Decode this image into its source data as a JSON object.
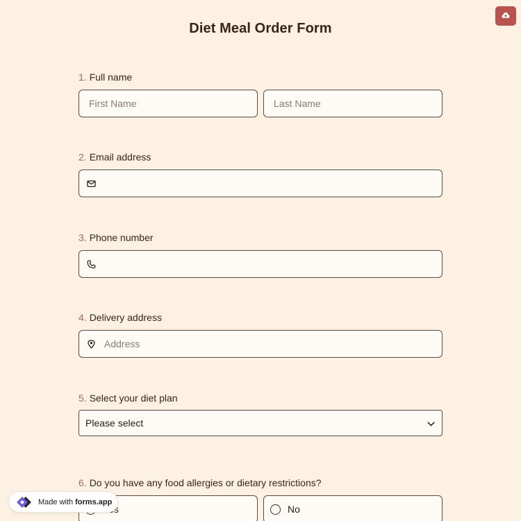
{
  "form": {
    "title": "Diet Meal Order Form"
  },
  "questions": {
    "q1": {
      "number": "1.",
      "label": "Full name",
      "first_placeholder": "First Name",
      "last_placeholder": "Last Name"
    },
    "q2": {
      "number": "2.",
      "label": "Email address",
      "icon": "envelope-icon"
    },
    "q3": {
      "number": "3.",
      "label": "Phone number",
      "icon": "phone-icon"
    },
    "q4": {
      "number": "4.",
      "label": "Delivery address",
      "icon": "map-pin-icon",
      "placeholder": "Address"
    },
    "q5": {
      "number": "5.",
      "label": "Select your diet plan",
      "selected": "Please select"
    },
    "q6": {
      "number": "6.",
      "label": "Do you have any food allergies or dietary restrictions?",
      "options": [
        "Yes",
        "No"
      ]
    }
  },
  "badge": {
    "prefix": "Made with",
    "brand": "forms.app"
  },
  "colors": {
    "background": "#fdf1e4",
    "accent": "#b85450",
    "number": "#a26b55"
  }
}
